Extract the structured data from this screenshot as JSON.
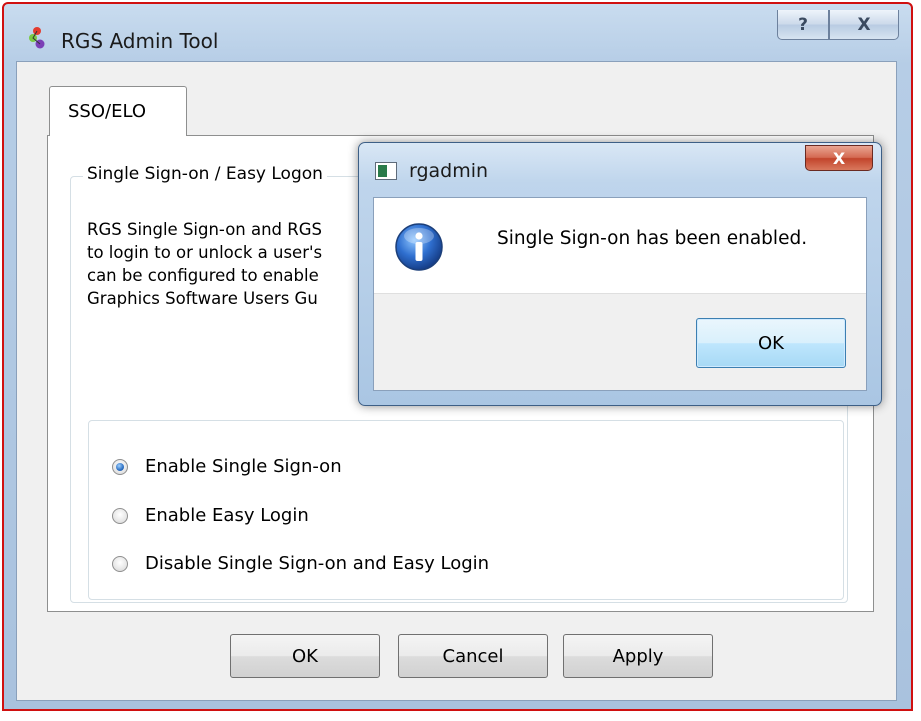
{
  "window": {
    "title": "RGS Admin Tool",
    "help_label": "?",
    "close_label": "X"
  },
  "tab": {
    "label": "SSO/ELO"
  },
  "group": {
    "title": "Single Sign-on / Easy Logon",
    "description": "RGS Single Sign-on and RGS\nto login to or unlock a user's\ncan be configured to enable\nGraphics Software Users Gu"
  },
  "options": [
    {
      "label": "Enable Single Sign-on",
      "checked": true
    },
    {
      "label": "Enable Easy Login",
      "checked": false
    },
    {
      "label": "Disable Single Sign-on and Easy Login",
      "checked": false
    }
  ],
  "buttons": {
    "ok": "OK",
    "cancel": "Cancel",
    "apply": "Apply"
  },
  "message_box": {
    "title": "rgadmin",
    "close_label": "X",
    "text": "Single Sign-on has been enabled.",
    "ok_label": "OK",
    "icon": "info-icon"
  },
  "colors": {
    "window_border": "#d01010",
    "title_bar": "#b6cde6",
    "msg_close": "#c2442b",
    "checked_radio": "#2c6fc2"
  }
}
